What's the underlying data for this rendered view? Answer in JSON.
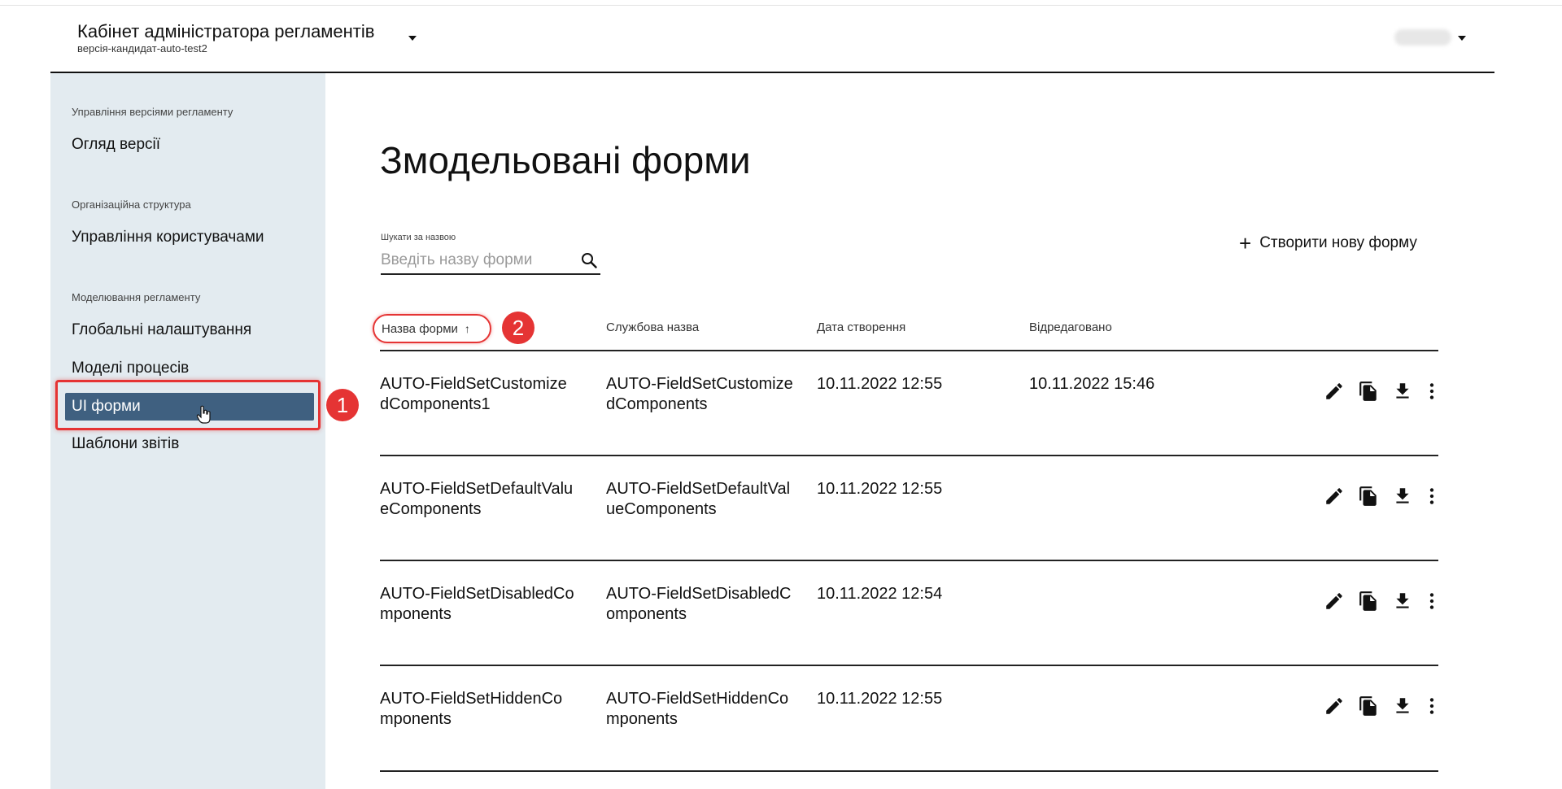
{
  "header": {
    "app_title": "Кабінет адміністратора регламентів",
    "version_name": "версія-кандидат-auto-test2"
  },
  "sidebar": {
    "groups": [
      {
        "label": "Управління версіями регламенту",
        "items": [
          {
            "label": "Огляд версії"
          }
        ]
      },
      {
        "label": "Організаційна структура",
        "items": [
          {
            "label": "Управління користувачами"
          }
        ]
      },
      {
        "label": "Моделювання регламенту",
        "items": [
          {
            "label": "Глобальні налаштування"
          },
          {
            "label": "Моделі процесів"
          },
          {
            "label": "UI форми",
            "active": true
          },
          {
            "label": "Шаблони звітів"
          }
        ]
      }
    ]
  },
  "annotations": {
    "badge_1": "1",
    "badge_2": "2"
  },
  "main": {
    "title": "Змодельовані форми",
    "search": {
      "label": "Шукати за назвою",
      "placeholder": "Введіть назву форми"
    },
    "create_button": "Створити нову форму",
    "columns": {
      "name": "Назва форми",
      "service_name": "Службова назва",
      "created": "Дата створення",
      "edited": "Відредаговано"
    },
    "rows": [
      {
        "name": "AUTO-FieldSetCustomizedComponents1",
        "service_name": "AUTO-FieldSetCustomizedComponents",
        "created": "10.11.2022 12:55",
        "edited": "10.11.2022 15:46"
      },
      {
        "name": "AUTO-FieldSetDefaultValueComponents",
        "service_name": "AUTO-FieldSetDefaultValueComponents",
        "created": "10.11.2022 12:55",
        "edited": ""
      },
      {
        "name": "AUTO-FieldSetDisabledComponents",
        "service_name": "AUTO-FieldSetDisabledComponents",
        "created": "10.11.2022 12:54",
        "edited": ""
      },
      {
        "name": "AUTO-FieldSetHiddenComponents",
        "service_name": "AUTO-FieldSetHiddenComponents",
        "created": "10.11.2022 12:55",
        "edited": ""
      }
    ],
    "row_action_icons": [
      "pencil-icon",
      "copy-icon",
      "download-icon",
      "more-vertical-icon"
    ]
  }
}
